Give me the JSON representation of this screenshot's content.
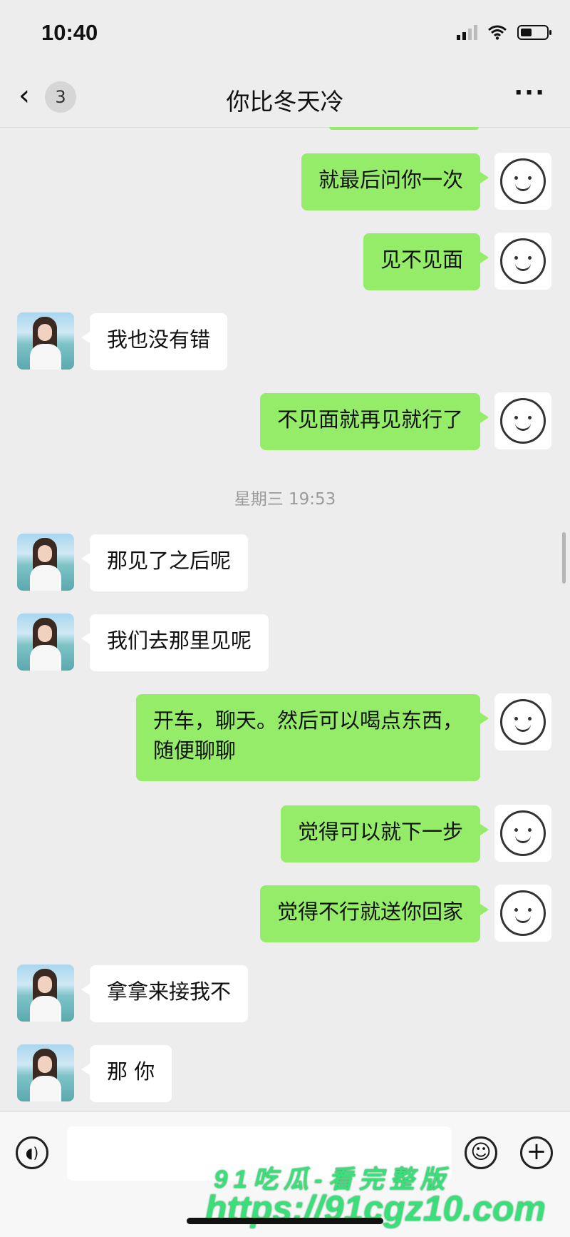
{
  "status_bar": {
    "time": "10:40",
    "battery_level": 0.45
  },
  "nav": {
    "back_icon": "‹",
    "unread_badge": "3",
    "title": "你比冬天冷",
    "more_icon": "···"
  },
  "chat": {
    "timestamp": "星期三 19:53",
    "messages_before": [
      {
        "from": "self",
        "text": "就最后问你一次"
      },
      {
        "from": "self",
        "text": "见不见面"
      },
      {
        "from": "other",
        "text": "我也没有错"
      },
      {
        "from": "self",
        "text": "不见面就再见就行了"
      }
    ],
    "messages_after": [
      {
        "from": "other",
        "text": "那见了之后呢"
      },
      {
        "from": "other",
        "text": "我们去那里见呢"
      },
      {
        "from": "self",
        "text": "开车，聊天。然后可以喝点东西，\n随便聊聊"
      },
      {
        "from": "self",
        "text": "觉得可以就下一步"
      },
      {
        "from": "self",
        "text": "觉得不行就送你回家"
      },
      {
        "from": "other",
        "text": "拿拿来接我不"
      },
      {
        "from": "other",
        "text": "那 你"
      }
    ]
  },
  "input_bar": {
    "voice_icon": "◖)",
    "emoji_icon": "☺",
    "plus_icon": "+"
  },
  "watermark": {
    "line1": "91吃瓜-看完整版",
    "line2": "https://91cgz10.com"
  },
  "colors": {
    "self_bubble": "#95ec69",
    "other_bubble": "#ffffff",
    "background": "#ededed",
    "watermark": "#39e07a"
  }
}
